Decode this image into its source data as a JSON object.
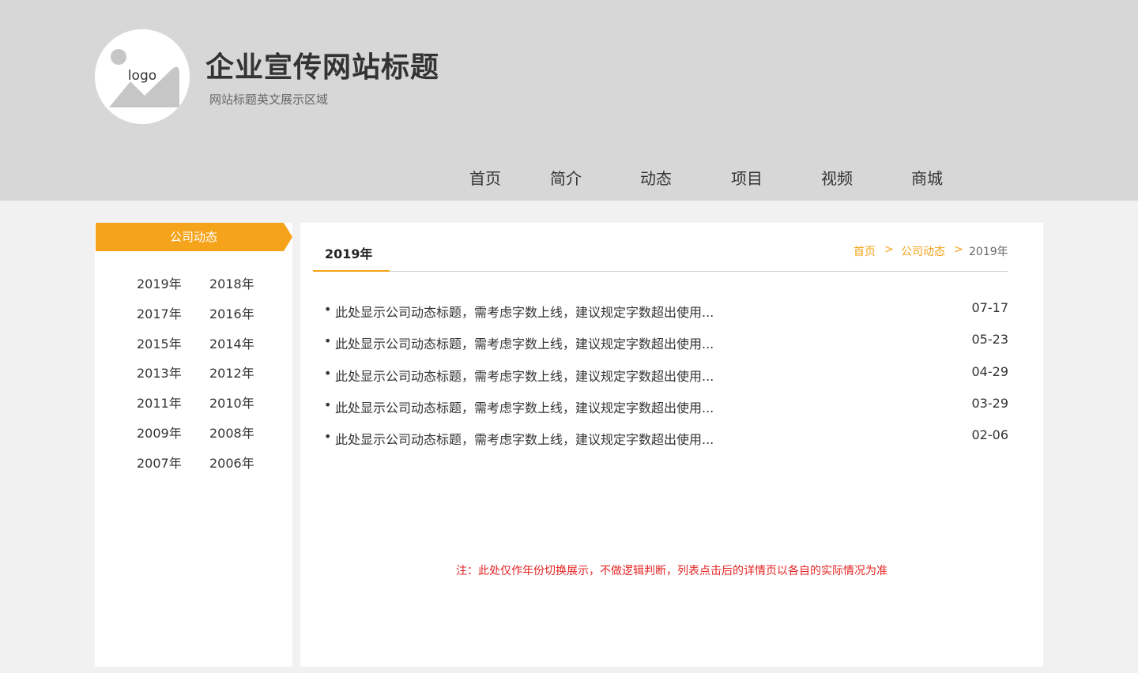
{
  "header": {
    "logo_text": "logo",
    "title": "企业宣传网站标题",
    "subtitle": "网站标题英文展示区域"
  },
  "nav": {
    "items": [
      {
        "label": "首页"
      },
      {
        "label": "简介"
      },
      {
        "label": "动态"
      },
      {
        "label": "项目"
      },
      {
        "label": "视频"
      },
      {
        "label": "商城"
      }
    ]
  },
  "sidebar": {
    "title": "公司动态",
    "years": [
      "2019年",
      "2018年",
      "2017年",
      "2016年",
      "2015年",
      "2014年",
      "2013年",
      "2012年",
      "2011年",
      "2010年",
      "2009年",
      "2008年",
      "2007年",
      "2006年"
    ]
  },
  "content": {
    "title": "2019年",
    "breadcrumb": {
      "home": "首页",
      "section": "公司动态",
      "current": "2019年",
      "separator": ">"
    },
    "news": [
      {
        "bullet": "•",
        "title": "此处显示公司动态标题，需考虑字数上线，建议规定字数超出使用...",
        "date": "07-17"
      },
      {
        "bullet": "•",
        "title": "此处显示公司动态标题，需考虑字数上线，建议规定字数超出使用...",
        "date": "05-23"
      },
      {
        "bullet": "•",
        "title": "此处显示公司动态标题，需考虑字数上线，建议规定字数超出使用...",
        "date": "04-29"
      },
      {
        "bullet": "•",
        "title": "此处显示公司动态标题，需考虑字数上线，建议规定字数超出使用...",
        "date": "03-29"
      },
      {
        "bullet": "•",
        "title": "此处显示公司动态标题，需考虑字数上线，建议规定字数超出使用...",
        "date": "02-06"
      }
    ],
    "note": "注：此处仅作年份切换展示，不做逻辑判断，列表点击后的详情页以各自的实际情况为准"
  },
  "colors": {
    "accent": "#f5a31a",
    "header_bg": "#d7d7d7",
    "page_bg": "#f1f1f1",
    "note": "#e52525"
  },
  "icons": {
    "logo": "image-placeholder-icon"
  }
}
